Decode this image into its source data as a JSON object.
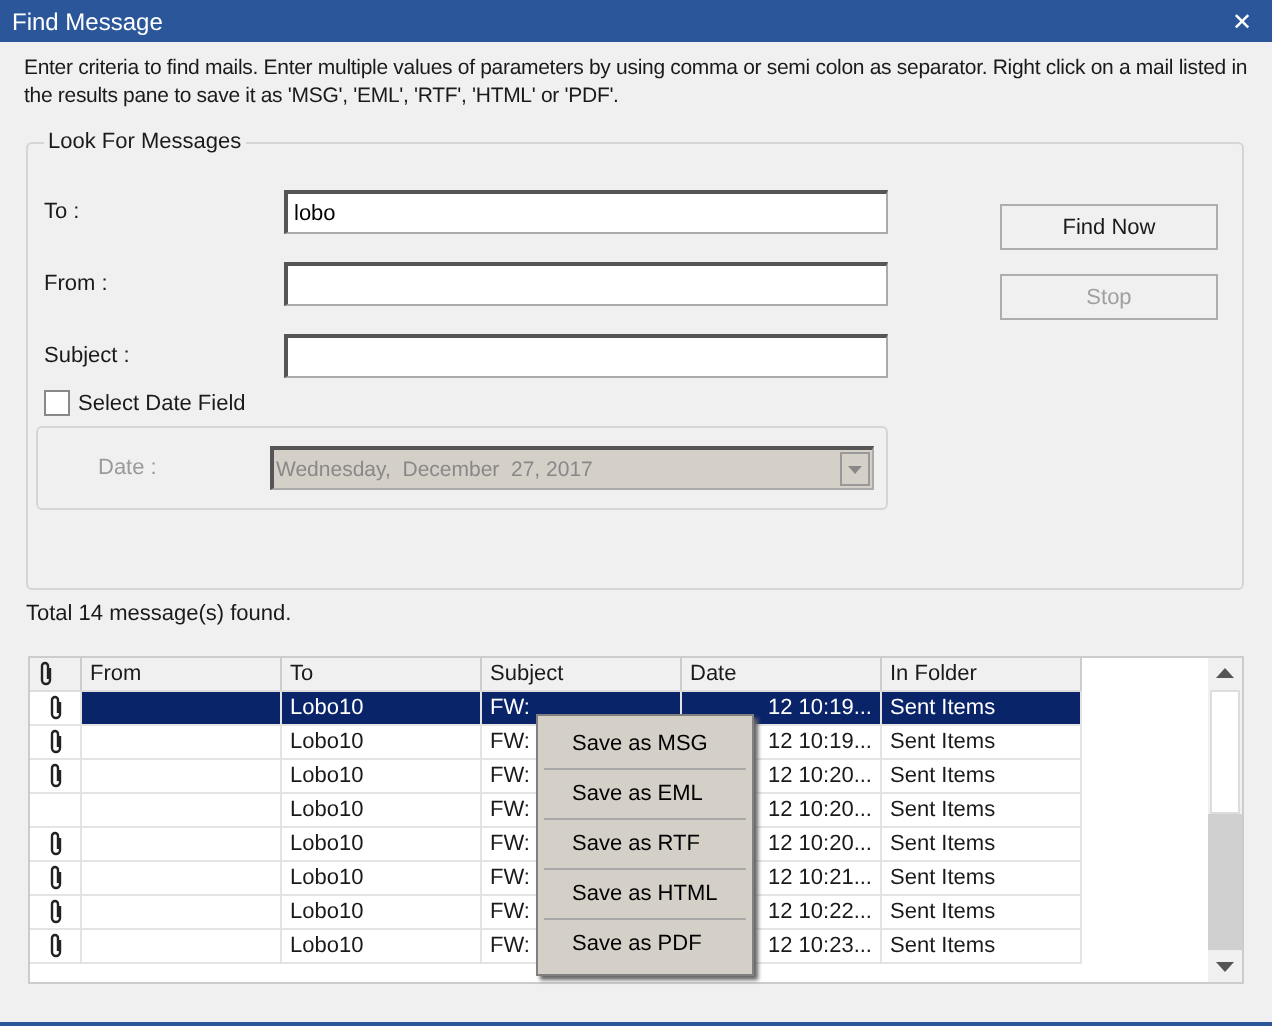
{
  "window": {
    "title": "Find Message",
    "close": "✕"
  },
  "instructions": "Enter criteria to find mails. Enter multiple values of parameters by using comma or semi colon as separator. Right click on a mail listed in the results pane to save it as 'MSG', 'EML', 'RTF', 'HTML' or 'PDF'.",
  "group": {
    "title": "Look For Messages",
    "fields": [
      {
        "label": "To :",
        "value": "lobo"
      },
      {
        "label": "From :"
      },
      {
        "label": "Subject :"
      }
    ],
    "date_checkbox": {
      "label": "Select Date Field",
      "checked": false
    },
    "date": {
      "label": "Date :",
      "value": "Wednesday,  December  27, 2017",
      "disabled": true
    },
    "buttons": [
      {
        "label": "Find Now",
        "disabled": false
      },
      {
        "label": "Stop",
        "disabled": true
      }
    ]
  },
  "status": "Total 14 message(s) found.",
  "table": {
    "columns": [
      "From",
      "To",
      "Subject",
      "Date",
      "In Folder"
    ],
    "rows": [
      {
        "attachment": true,
        "selected": true,
        "to": "Lobo10",
        "subject": "FW:",
        "date": "12 10:19...",
        "folder": "Sent Items"
      },
      {
        "attachment": true,
        "selected": false,
        "to": "Lobo10",
        "subject": "FW:",
        "date": "12 10:19...",
        "folder": "Sent Items"
      },
      {
        "attachment": true,
        "selected": false,
        "to": "Lobo10",
        "subject": "FW:",
        "date": "12 10:20...",
        "folder": "Sent Items"
      },
      {
        "attachment": false,
        "selected": false,
        "to": "Lobo10",
        "subject": "FW:",
        "date": "12 10:20...",
        "folder": "Sent Items"
      },
      {
        "attachment": true,
        "selected": false,
        "to": "Lobo10",
        "subject": "FW:",
        "date": "12 10:20...",
        "folder": "Sent Items"
      },
      {
        "attachment": true,
        "selected": false,
        "to": "Lobo10",
        "subject": "FW:",
        "date": "12 10:21...",
        "folder": "Sent Items"
      },
      {
        "attachment": true,
        "selected": false,
        "to": "Lobo10",
        "subject": "FW:",
        "date": "12 10:22...",
        "folder": "Sent Items"
      },
      {
        "attachment": true,
        "selected": false,
        "to": "Lobo10",
        "subject": "FW:",
        "date": "12 10:23...",
        "folder": "Sent Items"
      }
    ]
  },
  "context_menu": [
    "Save as MSG",
    "Save as EML",
    "Save as RTF",
    "Save as HTML",
    "Save as PDF"
  ]
}
